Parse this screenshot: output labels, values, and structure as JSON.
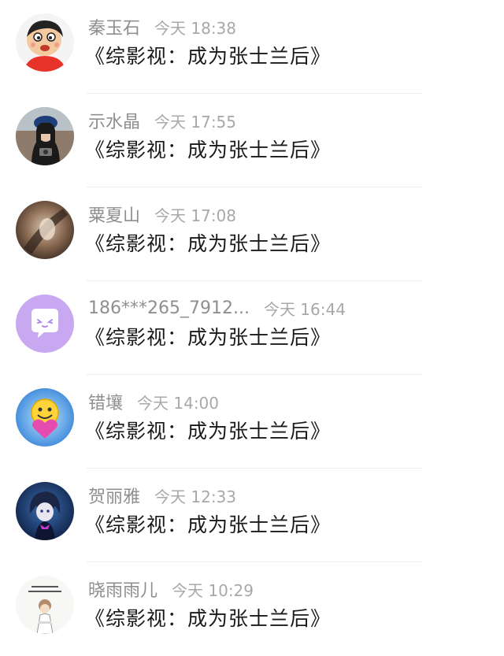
{
  "comments": [
    {
      "name": "秦玉石",
      "time": "今天 18:38",
      "text": "《综影视：成为张士兰后》",
      "avatar_icon": "cartoon-boy-icon"
    },
    {
      "name": "示水晶",
      "time": "今天 17:55",
      "text": "《综影视：成为张士兰后》",
      "avatar_icon": "girl-photo-icon"
    },
    {
      "name": "粟夏山",
      "time": "今天 17:08",
      "text": "《综影视：成为张士兰后》",
      "avatar_icon": "blurred-photo-icon"
    },
    {
      "name": "186***265_7912...",
      "time": "今天 16:44",
      "text": "《综影视：成为张士兰后》",
      "avatar_icon": "chat-bubble-icon"
    },
    {
      "name": "错壤",
      "time": "今天 14:00",
      "text": "《综影视：成为张士兰后》",
      "avatar_icon": "smiley-heart-icon"
    },
    {
      "name": "贺丽雅",
      "time": "今天 12:33",
      "text": "《综影视：成为张士兰后》",
      "avatar_icon": "anime-character-icon"
    },
    {
      "name": "晓雨雨儿",
      "time": "今天 10:29",
      "text": "《综影视：成为张士兰后》",
      "avatar_icon": "doll-drawing-icon"
    }
  ],
  "colors": {
    "name": "#8f8f8f",
    "time": "#a8a8a8",
    "text": "#1a1a1a",
    "divider": "#ededed",
    "chat_avatar_bg": "#c9a8f2"
  }
}
